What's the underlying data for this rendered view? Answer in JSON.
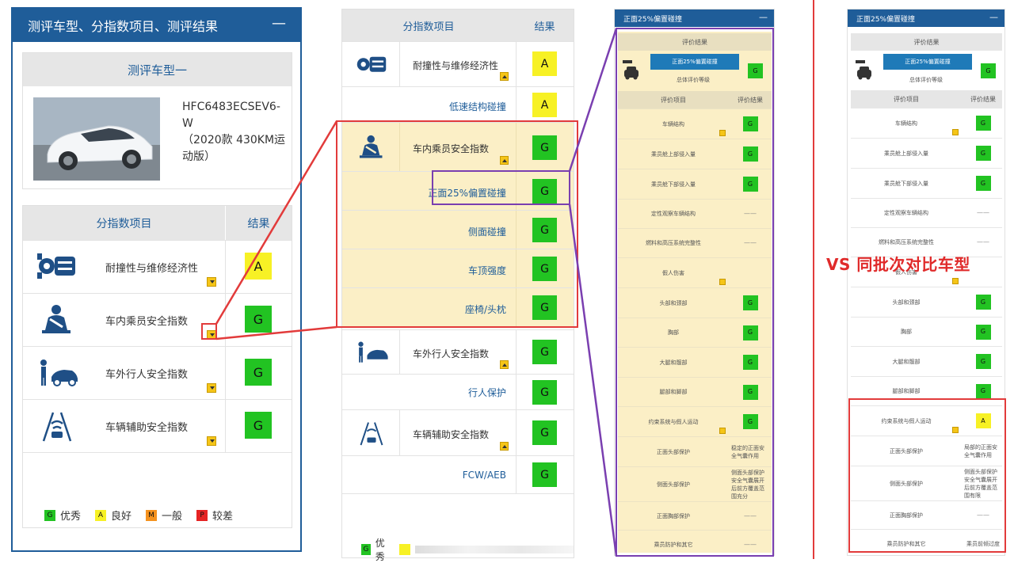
{
  "panel1": {
    "header_title": "测评车型、分指数项目、测评结果",
    "collapse_icon": "minus-icon",
    "model_box_title": "测评车型一",
    "model_code": "HFC6483ECSEV6-W",
    "model_desc": "（2020款 430KM运动版）",
    "table_header": {
      "item": "分指数项目",
      "result": "结果"
    },
    "rows": [
      {
        "icon": "engine-gear-icon",
        "name": "耐撞性与维修经济性",
        "grade": "A"
      },
      {
        "icon": "seated-passenger-icon",
        "name": "车内乘员安全指数",
        "grade": "G"
      },
      {
        "icon": "pedestrian-car-icon",
        "name": "车外行人安全指数",
        "grade": "G"
      },
      {
        "icon": "lane-assist-icon",
        "name": "车辆辅助安全指数",
        "grade": "G"
      }
    ],
    "legend": [
      {
        "code": "G",
        "label": "优秀",
        "color": "#22c322"
      },
      {
        "code": "A",
        "label": "良好",
        "color": "#f7f125"
      },
      {
        "code": "M",
        "label": "一般",
        "color": "#f5921e"
      },
      {
        "code": "P",
        "label": "较差",
        "color": "#e52323"
      }
    ]
  },
  "panel2": {
    "table_header": {
      "item": "分指数项目",
      "result": "结果"
    },
    "rows": [
      {
        "kind": "main",
        "name": "耐撞性与维修经济性",
        "grade": "A"
      },
      {
        "kind": "sub",
        "name": "低速结构碰撞",
        "grade": "A"
      },
      {
        "kind": "main",
        "name": "车内乘员安全指数",
        "grade": "G"
      },
      {
        "kind": "sub",
        "name": "正面25%偏置碰撞",
        "grade": "G"
      },
      {
        "kind": "sub",
        "name": "侧面碰撞",
        "grade": "G"
      },
      {
        "kind": "sub",
        "name": "车顶强度",
        "grade": "G"
      },
      {
        "kind": "sub",
        "name": "座椅/头枕",
        "grade": "G"
      },
      {
        "kind": "main",
        "name": "车外行人安全指数",
        "grade": "G"
      },
      {
        "kind": "sub",
        "name": "行人保护",
        "grade": "G"
      },
      {
        "kind": "main",
        "name": "车辆辅助安全指数",
        "grade": "G"
      },
      {
        "kind": "sub",
        "name": "FCW/AEB",
        "grade": "G"
      }
    ],
    "legend_first": {
      "code": "G",
      "label": "优秀"
    }
  },
  "panel3": {
    "header_title": "正面25%偏置碰撞",
    "eval_result_label": "评价结果",
    "tab_label": "正面25%偏置碰撞",
    "overall_label": "总体评价等级",
    "overall_grade": "G",
    "col_item": "评价项目",
    "col_result": "评价结果",
    "rows": [
      {
        "name": "车辆结构",
        "grade": "G",
        "tri": true
      },
      {
        "name": "乘员舱上部侵入量",
        "grade": "G"
      },
      {
        "name": "乘员舱下部侵入量",
        "grade": "G"
      },
      {
        "name": "定性观察车辆结构",
        "text": "——"
      },
      {
        "name": "燃料和高压系统完整性",
        "text": "——"
      },
      {
        "name": "假人伤害",
        "tri": true
      },
      {
        "name": "头部和颈部",
        "grade": "G"
      },
      {
        "name": "胸部",
        "grade": "G"
      },
      {
        "name": "大腿和髋部",
        "grade": "G"
      },
      {
        "name": "腿部和脚部",
        "grade": "G"
      },
      {
        "name": "约束系统与假人运动",
        "grade": "G",
        "tri": true
      },
      {
        "name": "正面头部保护",
        "text": "稳定的正面安全气囊作用"
      },
      {
        "name": "侧面头部保护",
        "text": "侧面头部保护安全气囊展开后前方覆盖范围充分"
      },
      {
        "name": "正面胸部保护",
        "text": "——"
      },
      {
        "name": "乘员防护和其它",
        "text": "——"
      }
    ]
  },
  "panel4": {
    "header_title": "正面25%偏置碰撞",
    "eval_result_label": "评价结果",
    "tab_label": "正面25%偏置碰撞",
    "overall_label": "总体评价等级",
    "overall_grade": "G",
    "col_item": "评价项目",
    "col_result": "评价结果",
    "rows": [
      {
        "name": "车辆结构",
        "grade": "G",
        "tri": true
      },
      {
        "name": "乘员舱上部侵入量",
        "grade": "G"
      },
      {
        "name": "乘员舱下部侵入量",
        "grade": "G"
      },
      {
        "name": "定性观察车辆结构",
        "text": "——"
      },
      {
        "name": "燃料和高压系统完整性",
        "text": "——"
      },
      {
        "name": "假人伤害",
        "tri": true
      },
      {
        "name": "头部和颈部",
        "grade": "G"
      },
      {
        "name": "胸部",
        "grade": "G"
      },
      {
        "name": "大腿和髋部",
        "grade": "G"
      },
      {
        "name": "腿部和脚部",
        "grade": "G"
      },
      {
        "name": "约束系统与假人运动",
        "grade": "A",
        "tri": true
      },
      {
        "name": "正面头部保护",
        "text": "局部的正面安全气囊作用"
      },
      {
        "name": "侧面头部保护",
        "text": "侧面头部保护安全气囊展开后前方覆盖范围有限"
      },
      {
        "name": "正面胸部保护",
        "text": "——"
      },
      {
        "name": "乘员防护和其它",
        "text": "乘员前倾过度"
      }
    ]
  },
  "annotation": {
    "vs_text": "VS 同批次对比车型"
  },
  "colors": {
    "brand_blue": "#1f5d99",
    "highlight_red": "#e23b3b",
    "highlight_purple": "#7a3fb0",
    "highlight_fill": "#fbefc6"
  }
}
